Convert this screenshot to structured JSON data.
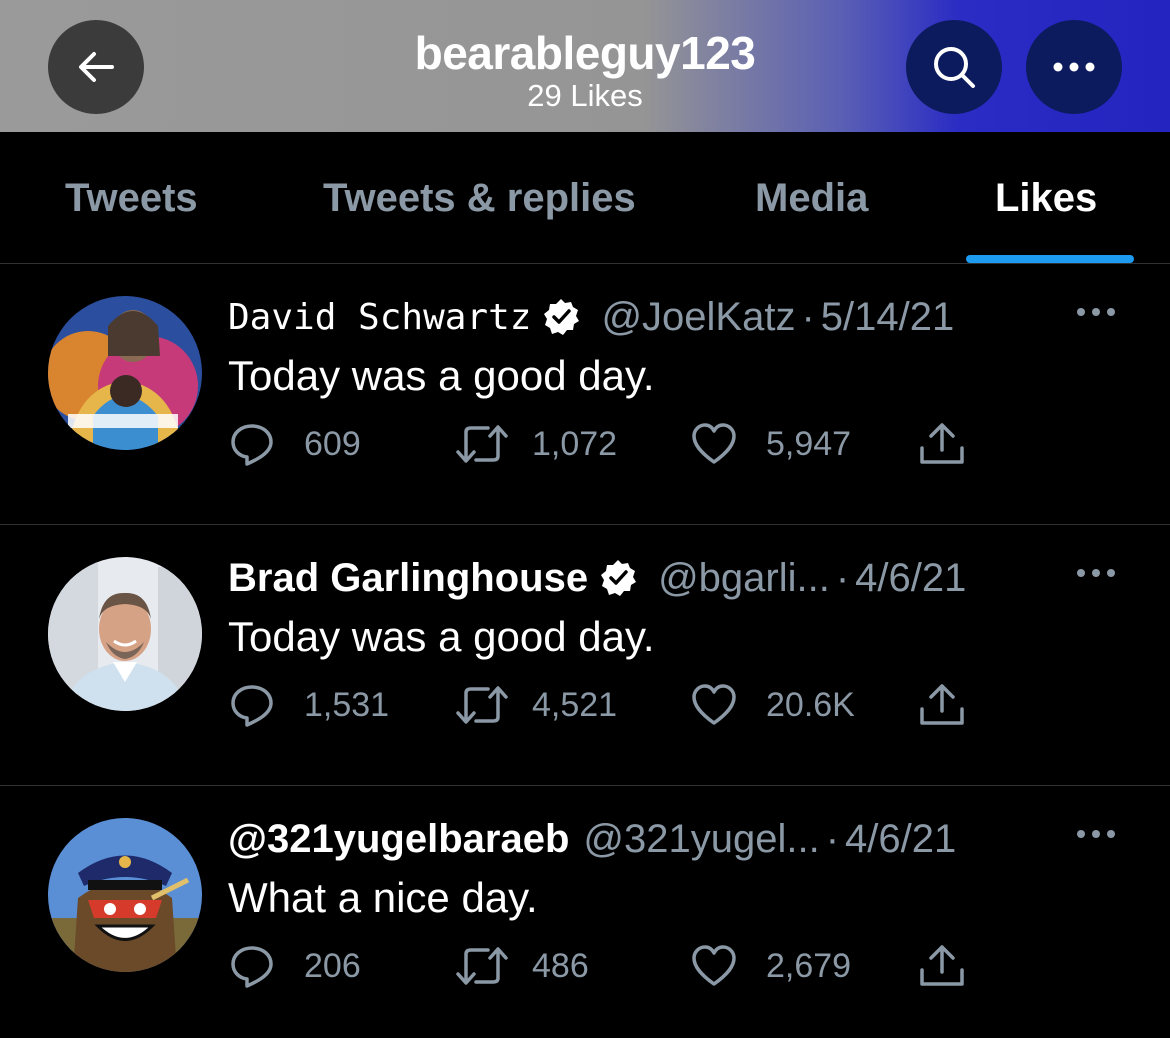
{
  "header": {
    "title": "bearableguy123",
    "subtitle": "29 Likes"
  },
  "tabs": [
    {
      "label": "Tweets",
      "active": false
    },
    {
      "label": "Tweets & replies",
      "active": false
    },
    {
      "label": "Media",
      "active": false
    },
    {
      "label": "Likes",
      "active": true
    }
  ],
  "tweets": [
    {
      "name": "David Schwartz",
      "verified": true,
      "handle": "@JoelKatz",
      "date": "5/14/21",
      "text": "Today was a good day.",
      "replies": "609",
      "retweets": "1,072",
      "likes": "5,947"
    },
    {
      "name": "Brad Garlinghouse",
      "verified": true,
      "handle": "@bgarli...",
      "date": "4/6/21",
      "text": "Today was a good day.",
      "replies": "1,531",
      "retweets": "4,521",
      "likes": "20.6K"
    },
    {
      "name": "@321yugelbaraeb",
      "verified": false,
      "handle": "@321yugel...",
      "date": "4/6/21",
      "text": "What a nice day.",
      "replies": "206",
      "retweets": "486",
      "likes": "2,679"
    }
  ],
  "colors": {
    "accent": "#1d9bf0",
    "background": "#000000",
    "muted": "#8b98a5"
  },
  "icons": [
    "back-arrow-icon",
    "search-icon",
    "more-icon",
    "verified-badge-icon",
    "reply-icon",
    "retweet-icon",
    "like-icon",
    "share-icon"
  ]
}
